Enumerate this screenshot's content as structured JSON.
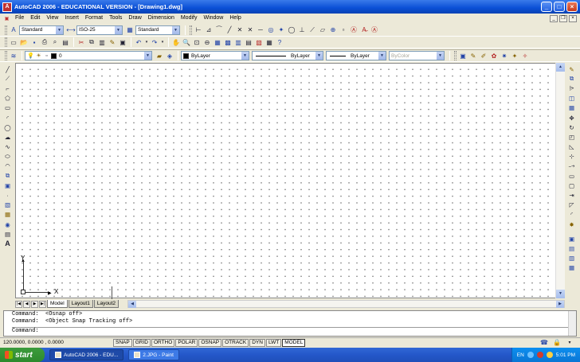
{
  "window": {
    "title": "AutoCAD 2006 - EDUCATIONAL VERSION - [Drawing1.dwg]",
    "app_icon": "A",
    "min": "_",
    "max": "□",
    "close": "×"
  },
  "menu": [
    "File",
    "Edit",
    "View",
    "Insert",
    "Format",
    "Tools",
    "Draw",
    "Dimension",
    "Modify",
    "Window",
    "Help"
  ],
  "styles": {
    "text_style": "Standard",
    "dim_style": "ISO-25",
    "table_style": "Standard"
  },
  "layers": {
    "current": "0"
  },
  "properties": {
    "color": "ByLayer",
    "linetype": "ByLayer",
    "lineweight": "ByLayer",
    "plotstyle": "ByColor"
  },
  "tabs": [
    "Model",
    "Layout1",
    "Layout2"
  ],
  "tab_nav": [
    "|◀",
    "◀",
    "▶",
    "▶|"
  ],
  "ucs": {
    "x": "X",
    "y": "Y"
  },
  "command": {
    "lines": [
      "Command:  <Osnap off>",
      "Command:  <Object Snap Tracking off>"
    ],
    "prompt": "Command:"
  },
  "status": {
    "coords": "120.0000, 0.0000 , 0.0000",
    "buttons": [
      "SNAP",
      "GRID",
      "ORTHO",
      "POLAR",
      "OSNAP",
      "OTRACK",
      "DYN",
      "LWT",
      "MODEL"
    ]
  },
  "taskbar": {
    "start": "start",
    "tasks": [
      "AutoCAD 2006 - EDU...",
      "2.JPG - Paint"
    ],
    "lang": "EN",
    "clock": "5:01 PM"
  }
}
